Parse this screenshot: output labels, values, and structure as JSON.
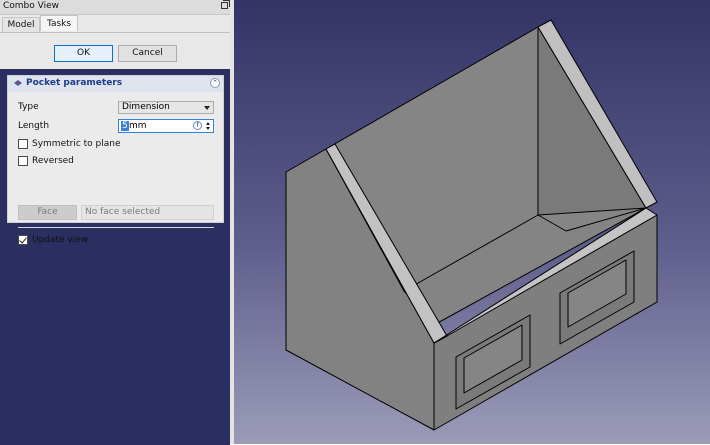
{
  "window": {
    "title": "Combo View"
  },
  "tabs": [
    {
      "label": "Model"
    },
    {
      "label": "Tasks"
    }
  ],
  "dialog_buttons": {
    "ok": "OK",
    "cancel": "Cancel"
  },
  "pocket_parameters": {
    "title": "Pocket parameters",
    "type": {
      "label": "Type",
      "value": "Dimension"
    },
    "length": {
      "label": "Length",
      "value": "5",
      "unit": "mm"
    },
    "symmetric": {
      "label": "Symmetric to plane",
      "checked": false
    },
    "reversed": {
      "label": "Reversed",
      "checked": false
    },
    "face": {
      "button_label": "Face",
      "placeholder": "No face selected"
    },
    "update_view": {
      "label": "Update view",
      "checked": true
    }
  },
  "icons": {
    "float": "float-window-icon",
    "pocket": "pocket-icon",
    "collapse": "collapse-chevron-icon",
    "expression": "expression-icon"
  },
  "colors": {
    "viewport_top": "#333366",
    "viewport_bottom": "#9b9bb8",
    "solid_fill": "#808080",
    "solid_edge": "#000000",
    "header_title": "#1d3c8a"
  }
}
